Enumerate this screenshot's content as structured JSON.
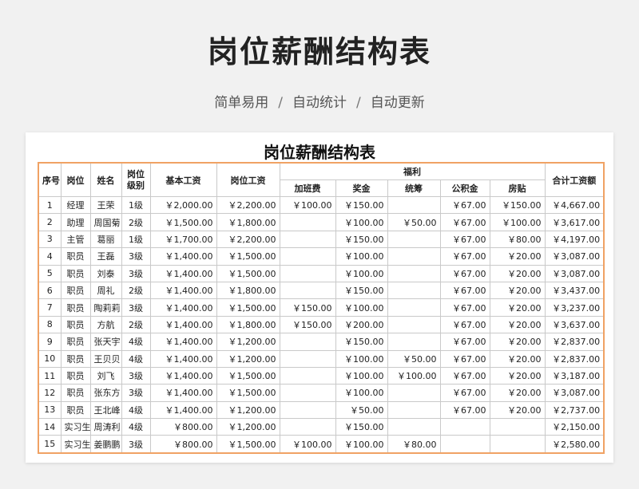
{
  "title": "岗位薪酬结构表",
  "subtitle": [
    "简单易用",
    "自动统计",
    "自动更新"
  ],
  "separator": "/",
  "sheet": {
    "title": "岗位薪酬结构表",
    "headers": {
      "seq": "序号",
      "position": "岗位",
      "name": "姓名",
      "level": "岗位级别",
      "base": "基本工资",
      "post": "岗位工资",
      "welfare": "福利",
      "overtime": "加班费",
      "bonus": "奖金",
      "planning": "统筹",
      "fund": "公积金",
      "housing": "房贴",
      "total": "合计工资额"
    },
    "rows": [
      [
        "1",
        "经理",
        "王荣",
        "1级",
        "￥2,000.00",
        "￥2,200.00",
        "￥100.00",
        "￥150.00",
        "",
        "￥67.00",
        "￥150.00",
        "￥4,667.00"
      ],
      [
        "2",
        "助理",
        "周国菊",
        "2级",
        "￥1,500.00",
        "￥1,800.00",
        "",
        "￥100.00",
        "￥50.00",
        "￥67.00",
        "￥100.00",
        "￥3,617.00"
      ],
      [
        "3",
        "主管",
        "葛丽",
        "1级",
        "￥1,700.00",
        "￥2,200.00",
        "",
        "￥150.00",
        "",
        "￥67.00",
        "￥80.00",
        "￥4,197.00"
      ],
      [
        "4",
        "职员",
        "王磊",
        "3级",
        "￥1,400.00",
        "￥1,500.00",
        "",
        "￥100.00",
        "",
        "￥67.00",
        "￥20.00",
        "￥3,087.00"
      ],
      [
        "5",
        "职员",
        "刘泰",
        "3级",
        "￥1,400.00",
        "￥1,500.00",
        "",
        "￥100.00",
        "",
        "￥67.00",
        "￥20.00",
        "￥3,087.00"
      ],
      [
        "6",
        "职员",
        "周礼",
        "2级",
        "￥1,400.00",
        "￥1,800.00",
        "",
        "￥150.00",
        "",
        "￥67.00",
        "￥20.00",
        "￥3,437.00"
      ],
      [
        "7",
        "职员",
        "陶莉莉",
        "3级",
        "￥1,400.00",
        "￥1,500.00",
        "￥150.00",
        "￥100.00",
        "",
        "￥67.00",
        "￥20.00",
        "￥3,237.00"
      ],
      [
        "8",
        "职员",
        "方航",
        "2级",
        "￥1,400.00",
        "￥1,800.00",
        "￥150.00",
        "￥200.00",
        "",
        "￥67.00",
        "￥20.00",
        "￥3,637.00"
      ],
      [
        "9",
        "职员",
        "张天宇",
        "4级",
        "￥1,400.00",
        "￥1,200.00",
        "",
        "￥150.00",
        "",
        "￥67.00",
        "￥20.00",
        "￥2,837.00"
      ],
      [
        "10",
        "职员",
        "王贝贝",
        "4级",
        "￥1,400.00",
        "￥1,200.00",
        "",
        "￥100.00",
        "￥50.00",
        "￥67.00",
        "￥20.00",
        "￥2,837.00"
      ],
      [
        "11",
        "职员",
        "刘飞",
        "3级",
        "￥1,400.00",
        "￥1,500.00",
        "",
        "￥100.00",
        "￥100.00",
        "￥67.00",
        "￥20.00",
        "￥3,187.00"
      ],
      [
        "12",
        "职员",
        "张东方",
        "3级",
        "￥1,400.00",
        "￥1,500.00",
        "",
        "￥100.00",
        "",
        "￥67.00",
        "￥20.00",
        "￥3,087.00"
      ],
      [
        "13",
        "职员",
        "王北峰",
        "4级",
        "￥1,400.00",
        "￥1,200.00",
        "",
        "￥50.00",
        "",
        "￥67.00",
        "￥20.00",
        "￥2,737.00"
      ],
      [
        "14",
        "实习生",
        "周涛利",
        "4级",
        "￥800.00",
        "￥1,200.00",
        "",
        "￥150.00",
        "",
        "",
        "",
        "￥2,150.00"
      ],
      [
        "15",
        "实习生",
        "姜鹏鹏",
        "3级",
        "￥800.00",
        "￥1,500.00",
        "￥100.00",
        "￥100.00",
        "￥80.00",
        "",
        "",
        "￥2,580.00"
      ]
    ]
  },
  "colors": {
    "table_border": "#f0a264",
    "background": "#f1f1f1"
  }
}
